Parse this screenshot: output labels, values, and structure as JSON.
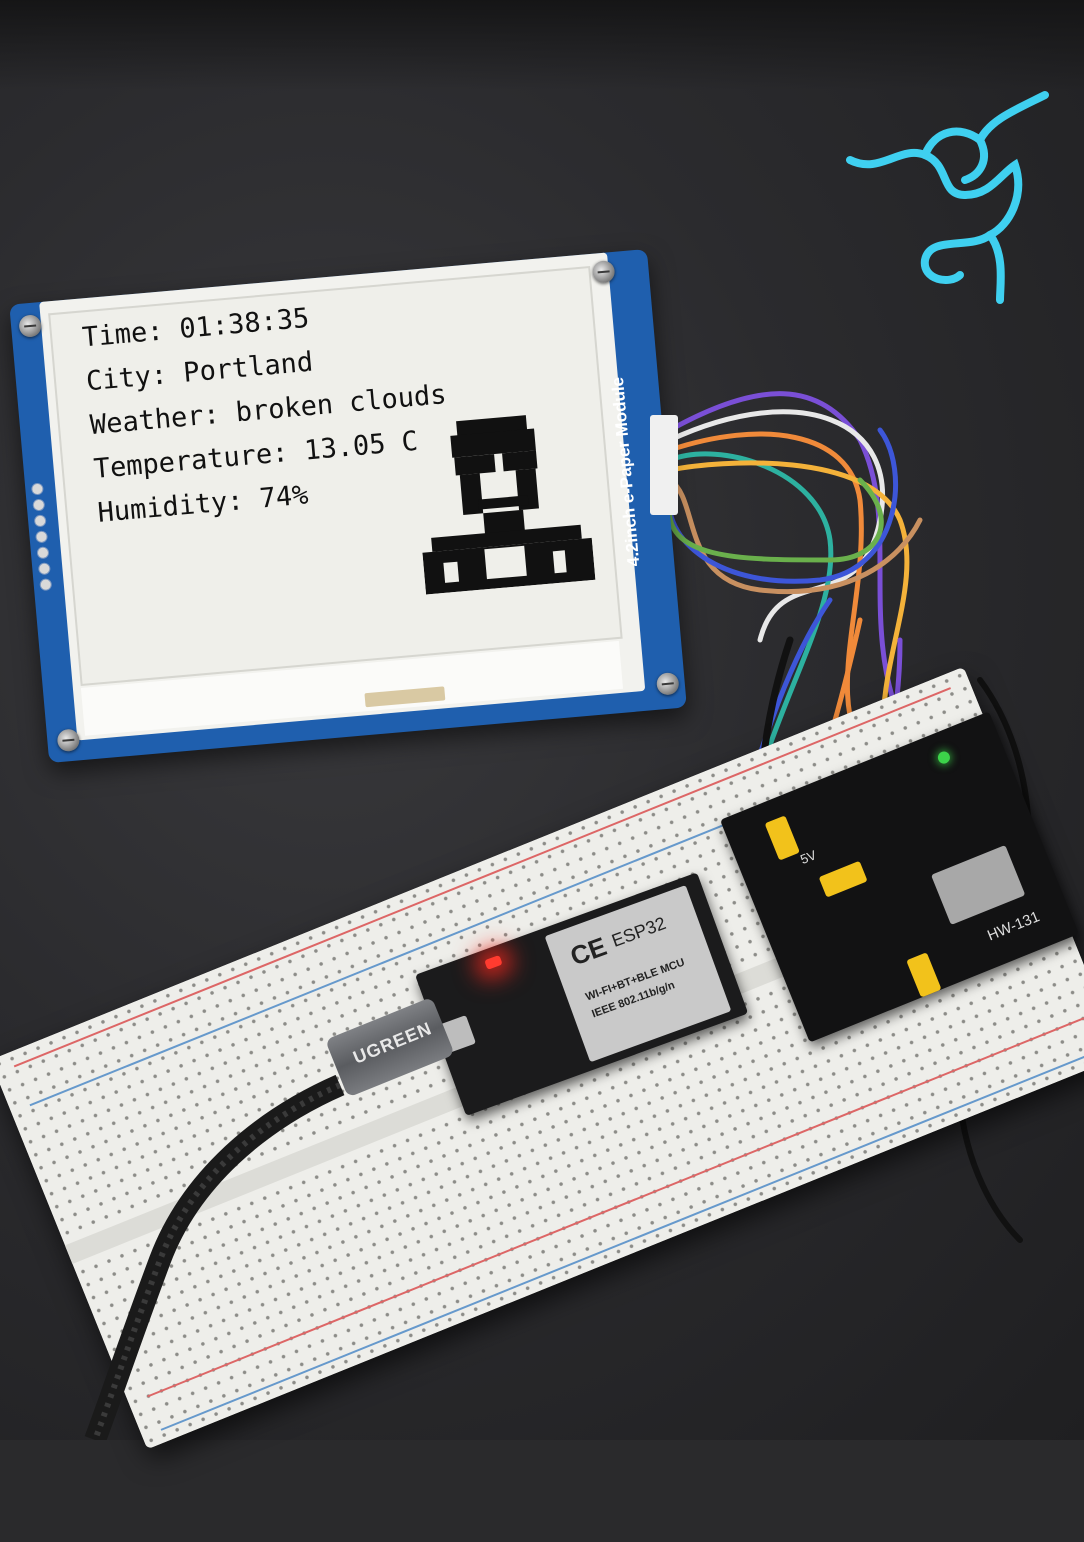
{
  "epaper": {
    "readout": {
      "time": "Time: 01:38:35",
      "city": "City: Portland",
      "weather": "Weather: broken clouds",
      "temperature": "Temperature: 13.05 C",
      "humidity": "Humidity: 74%"
    },
    "module_label": "4.2inch e-Paper Module"
  },
  "esp32": {
    "chip_label": "ESP32",
    "ce_mark": "CE",
    "line1": "WI-FI+BT+BLE MCU",
    "line2": "IEEE 802.11b/g/n"
  },
  "power_module": {
    "label": "HW-131",
    "voltage_label": "5V"
  },
  "cable": {
    "brand": "UGREEN"
  },
  "colors": {
    "desk": "#2b2b2e",
    "pcb_blue": "#1f5fae",
    "logo_cyan": "#3fd0f0",
    "led_red": "#ff3b2f"
  }
}
